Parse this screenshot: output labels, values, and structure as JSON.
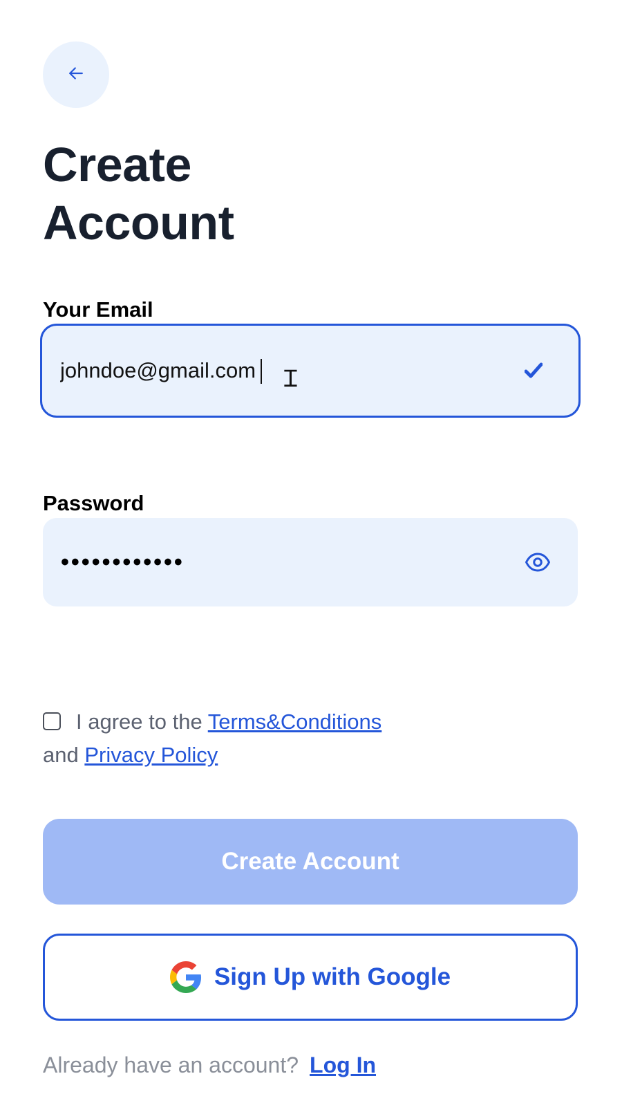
{
  "back_button": {
    "icon": "arrow-left-icon"
  },
  "title": {
    "line1": "Create",
    "line2": "Account"
  },
  "email": {
    "label": "Your Email",
    "value": "johndoe@gmail.com",
    "status_icon": "checkmark-icon"
  },
  "password": {
    "label": "Password",
    "masked_value": "••••••••••••",
    "toggle_icon": "eye-icon"
  },
  "agreement": {
    "prefix": "I agree to the",
    "terms_link": "Terms&Conditions",
    "middle": "and",
    "privacy_link": "Privacy Policy",
    "checked": false
  },
  "create_button": {
    "label": "Create Account"
  },
  "google_button": {
    "label": "Sign Up with Google",
    "icon": "google-icon"
  },
  "footer": {
    "prompt": "Already have an account?",
    "login_link": "Log In"
  },
  "colors": {
    "accent": "#2456d9",
    "field_bg": "#eaf2fd",
    "primary_disabled": "#9fb9f5",
    "title_text": "#18202e"
  }
}
